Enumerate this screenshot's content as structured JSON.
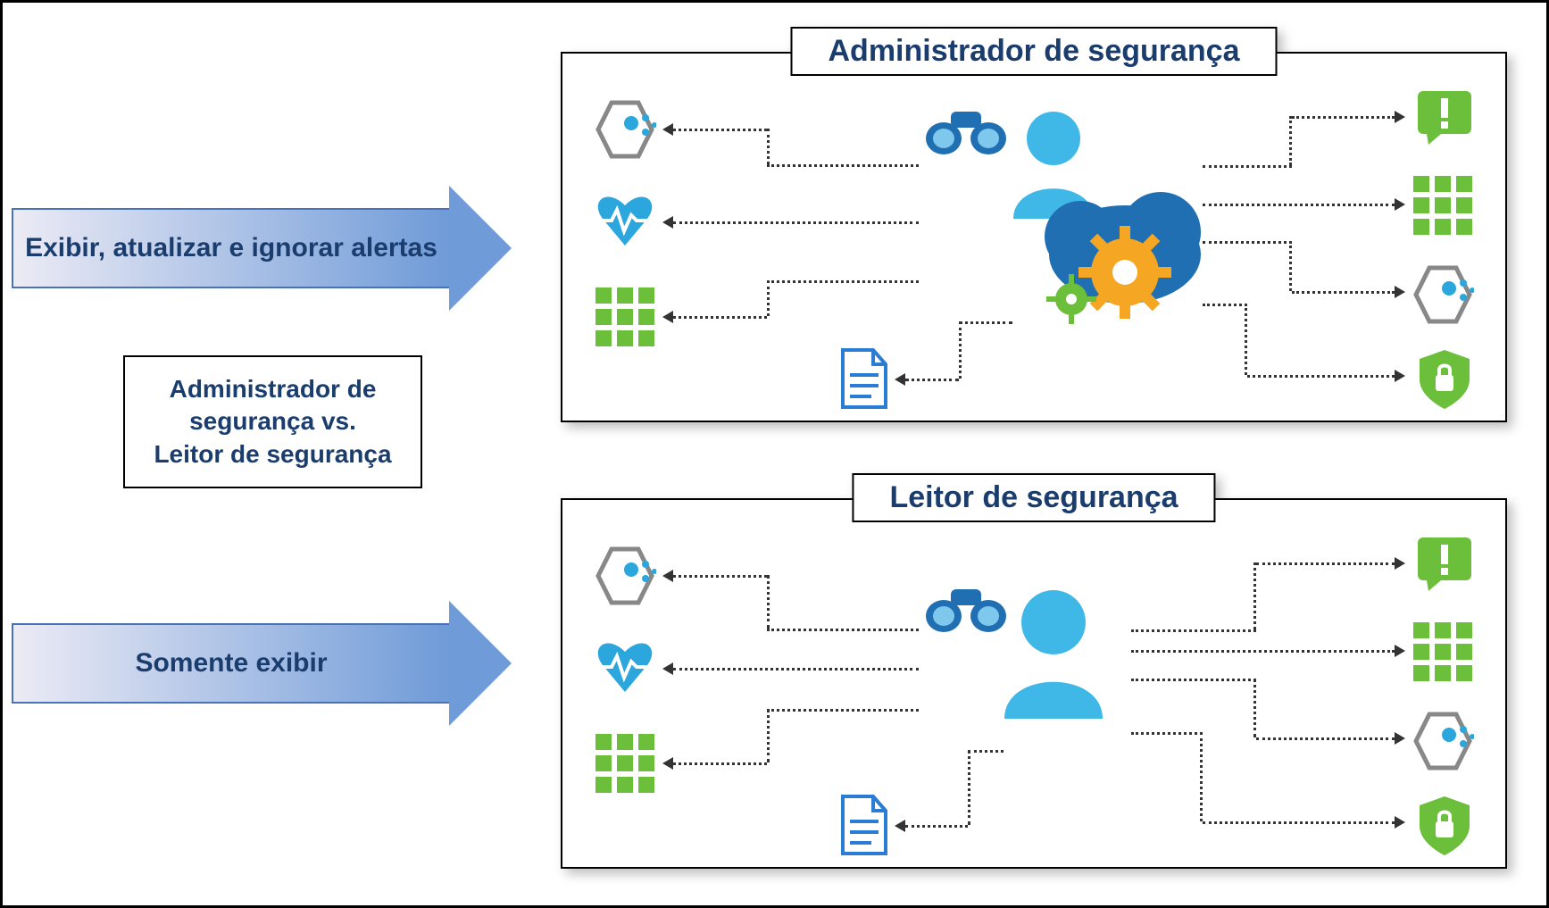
{
  "arrows": {
    "top": "Exibir, atualizar e ignorar alertas",
    "bottom": "Somente exibir"
  },
  "mid_box": {
    "line1": "Administrador de",
    "line2": "segurança vs.",
    "line3": "Leitor de segurança"
  },
  "panels": {
    "admin": {
      "title": "Administrador de segurança",
      "left_icons": [
        "hexagon-cluster-icon",
        "heartbeat-icon",
        "grid-icon"
      ],
      "center_icons": [
        "binoculars-icon",
        "user-icon",
        "cloud-gear-icon",
        "document-icon"
      ],
      "right_icons": [
        "alert-icon",
        "grid-icon",
        "hexagon-cluster-icon",
        "shield-lock-icon"
      ]
    },
    "reader": {
      "title": "Leitor de segurança",
      "left_icons": [
        "hexagon-cluster-icon",
        "heartbeat-icon",
        "grid-icon"
      ],
      "center_icons": [
        "binoculars-icon",
        "user-icon",
        "document-icon"
      ],
      "right_icons": [
        "alert-icon",
        "grid-icon",
        "hexagon-cluster-icon",
        "shield-lock-icon"
      ]
    }
  },
  "colors": {
    "title_text": "#1a3d6d",
    "azure_blue": "#2ba7dd",
    "azure_dark": "#1f6fb2",
    "green": "#6bbf3b",
    "orange": "#f5a623"
  }
}
